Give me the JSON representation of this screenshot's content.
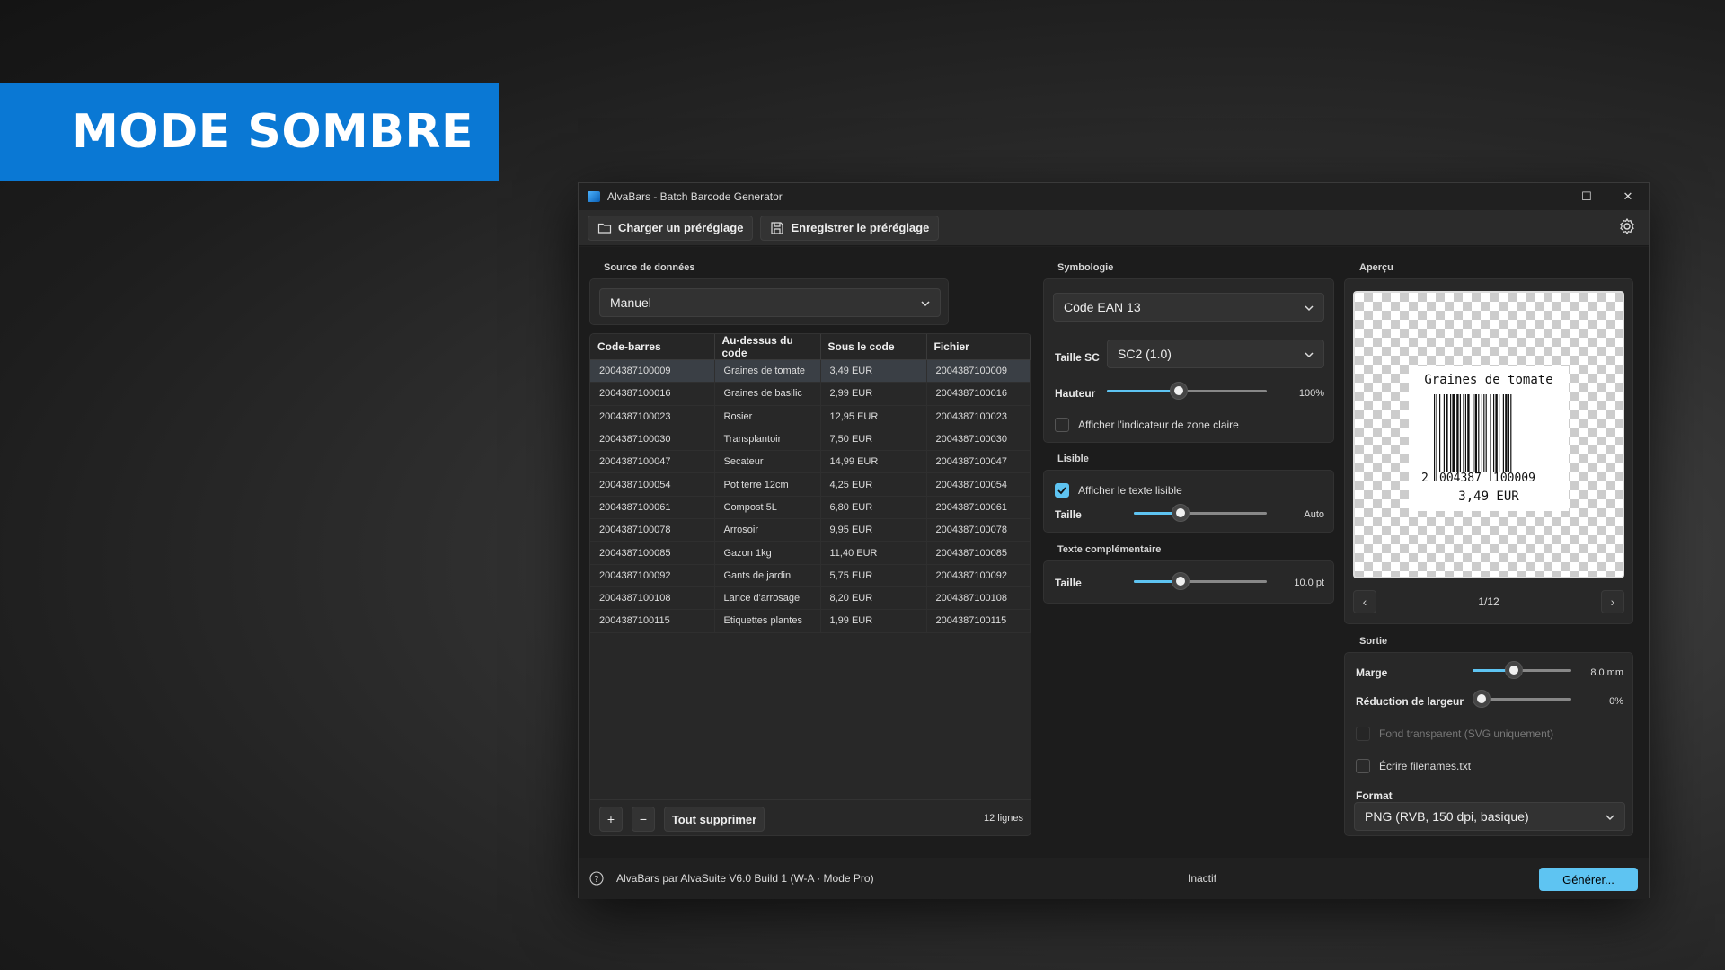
{
  "banner": {
    "text": "MODE SOMBRE"
  },
  "window": {
    "title": "AlvaBars - Batch Barcode Generator"
  },
  "toolbar": {
    "load_preset": "Charger un préréglage",
    "save_preset": "Enregistrer le préréglage"
  },
  "datasource": {
    "section_label": "Source de données",
    "selected": "Manuel",
    "columns": [
      "Code-barres",
      "Au-dessus du code",
      "Sous le code",
      "Fichier"
    ],
    "rows": [
      [
        "2004387100009",
        "Graines de tomate",
        "3,49 EUR",
        "2004387100009"
      ],
      [
        "2004387100016",
        "Graines de basilic",
        "2,99 EUR",
        "2004387100016"
      ],
      [
        "2004387100023",
        "Rosier",
        "12,95 EUR",
        "2004387100023"
      ],
      [
        "2004387100030",
        "Transplantoir",
        "7,50 EUR",
        "2004387100030"
      ],
      [
        "2004387100047",
        "Secateur",
        "14,99 EUR",
        "2004387100047"
      ],
      [
        "2004387100054",
        "Pot terre 12cm",
        "4,25 EUR",
        "2004387100054"
      ],
      [
        "2004387100061",
        "Compost 5L",
        "6,80 EUR",
        "2004387100061"
      ],
      [
        "2004387100078",
        "Arrosoir",
        "9,95 EUR",
        "2004387100078"
      ],
      [
        "2004387100085",
        "Gazon 1kg",
        "11,40 EUR",
        "2004387100085"
      ],
      [
        "2004387100092",
        "Gants de jardin",
        "5,75 EUR",
        "2004387100092"
      ],
      [
        "2004387100108",
        "Lance d'arrosage",
        "8,20 EUR",
        "2004387100108"
      ],
      [
        "2004387100115",
        "Etiquettes plantes",
        "1,99 EUR",
        "2004387100115"
      ]
    ],
    "add_label": "+",
    "remove_label": "−",
    "clear_all": "Tout supprimer",
    "row_count": "12 lignes"
  },
  "symbology": {
    "section_label": "Symbologie",
    "selected": "Code EAN 13",
    "size_label": "Taille SC",
    "size_value": "SC2 (1.0)",
    "height_label": "Hauteur",
    "height_value": "100%",
    "height_fraction": 0.45,
    "quiet_zone_label": "Afficher l'indicateur de zone claire",
    "quiet_zone_checked": false
  },
  "readable": {
    "section_label": "Lisible",
    "show_text_label": "Afficher le texte lisible",
    "show_text_checked": true,
    "size_label": "Taille",
    "size_value": "Auto",
    "size_fraction": 0.35
  },
  "extra_text": {
    "section_label": "Texte complémentaire",
    "size_label": "Taille",
    "size_value": "10.0 pt",
    "size_fraction": 0.35
  },
  "preview": {
    "section_label": "Aperçu",
    "top_text": "Graines de tomate",
    "digit_first": "2",
    "digits_left": "004387",
    "digits_right": "100009",
    "bottom_text": "3,49 EUR",
    "page": "1/12"
  },
  "output": {
    "section_label": "Sortie",
    "margin_label": "Marge",
    "margin_value": "8.0 mm",
    "margin_fraction": 0.42,
    "width_red_label": "Réduction de largeur",
    "width_red_value": "0%",
    "width_red_fraction": 0.0,
    "transparent_label": "Fond transparent (SVG uniquement)",
    "write_filenames_label": "Écrire filenames.txt",
    "format_label": "Format",
    "format_value": "PNG (RVB, 150 dpi, basique)"
  },
  "status": {
    "version": "AlvaBars par AlvaSuite V6.0 Build 1 (W-A · Mode Pro)",
    "state": "Inactif",
    "generate": "Générer..."
  },
  "colors": {
    "accent": "#5ec4f2",
    "banner": "#0a78d4"
  }
}
